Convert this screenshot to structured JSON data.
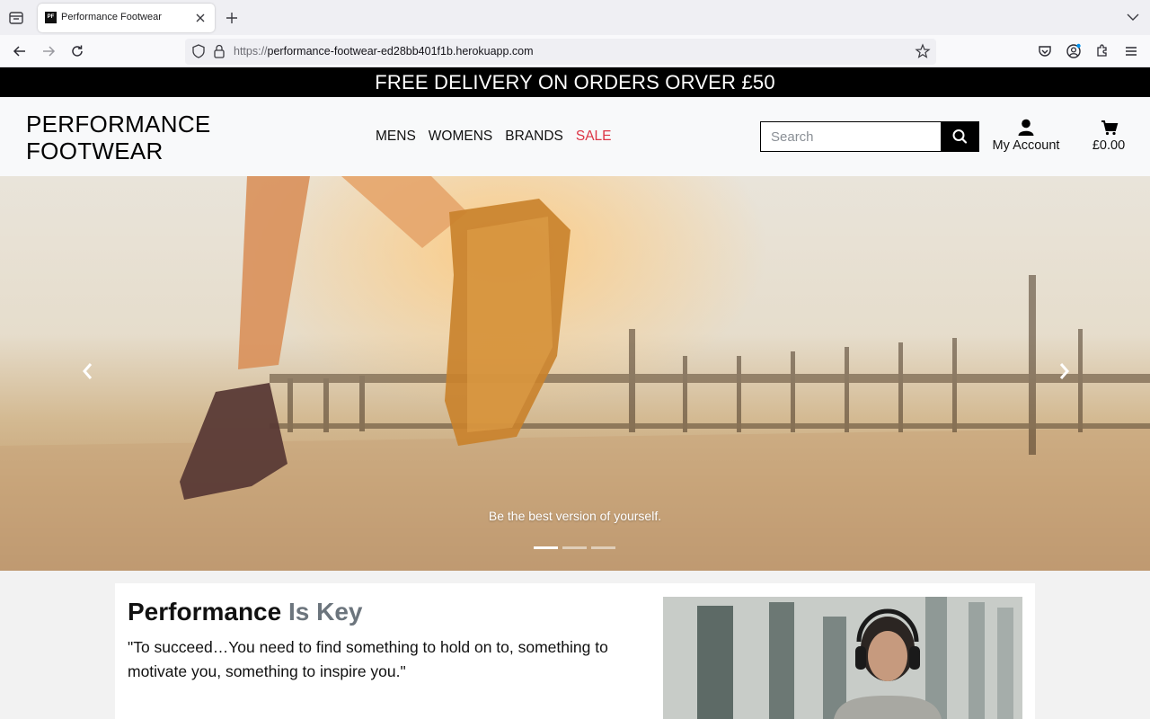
{
  "browser": {
    "tab_title": "Performance Footwear",
    "favicon_text": "PF",
    "url_protocol": "https://",
    "url_host": "performance-footwear-ed28bb401f1b.herokuapp.com"
  },
  "promo": {
    "text": "FREE DELIVERY ON ORDERS ORVER £50"
  },
  "header": {
    "logo_line1": "PERFORMANCE",
    "logo_line2": "FOOTWEAR",
    "nav": [
      "MENS",
      "WOMENS",
      "BRANDS",
      "SALE"
    ],
    "search_placeholder": "Search",
    "account_label": "My Account",
    "bag_total": "£0.00",
    "sale_color": "#dc3545"
  },
  "hero": {
    "caption": "Be the best version of yourself.",
    "slides_total": 3,
    "active_slide": 1
  },
  "content": {
    "heading_main": "Performance",
    "heading_muted": "Is Key",
    "quote": "\"To succeed…You need to find something to hold on to, something to motivate you, something to inspire you.\""
  },
  "icons": [
    "tab-list-icon",
    "close-icon",
    "plus-icon",
    "chevron-down-icon",
    "back-arrow-icon",
    "forward-arrow-icon",
    "reload-icon",
    "shield-icon",
    "lock-icon",
    "star-icon",
    "pocket-icon",
    "account-icon",
    "extensions-icon",
    "menu-icon",
    "search-icon",
    "user-icon",
    "shopping-cart-icon",
    "chevron-left-icon",
    "chevron-right-icon"
  ]
}
